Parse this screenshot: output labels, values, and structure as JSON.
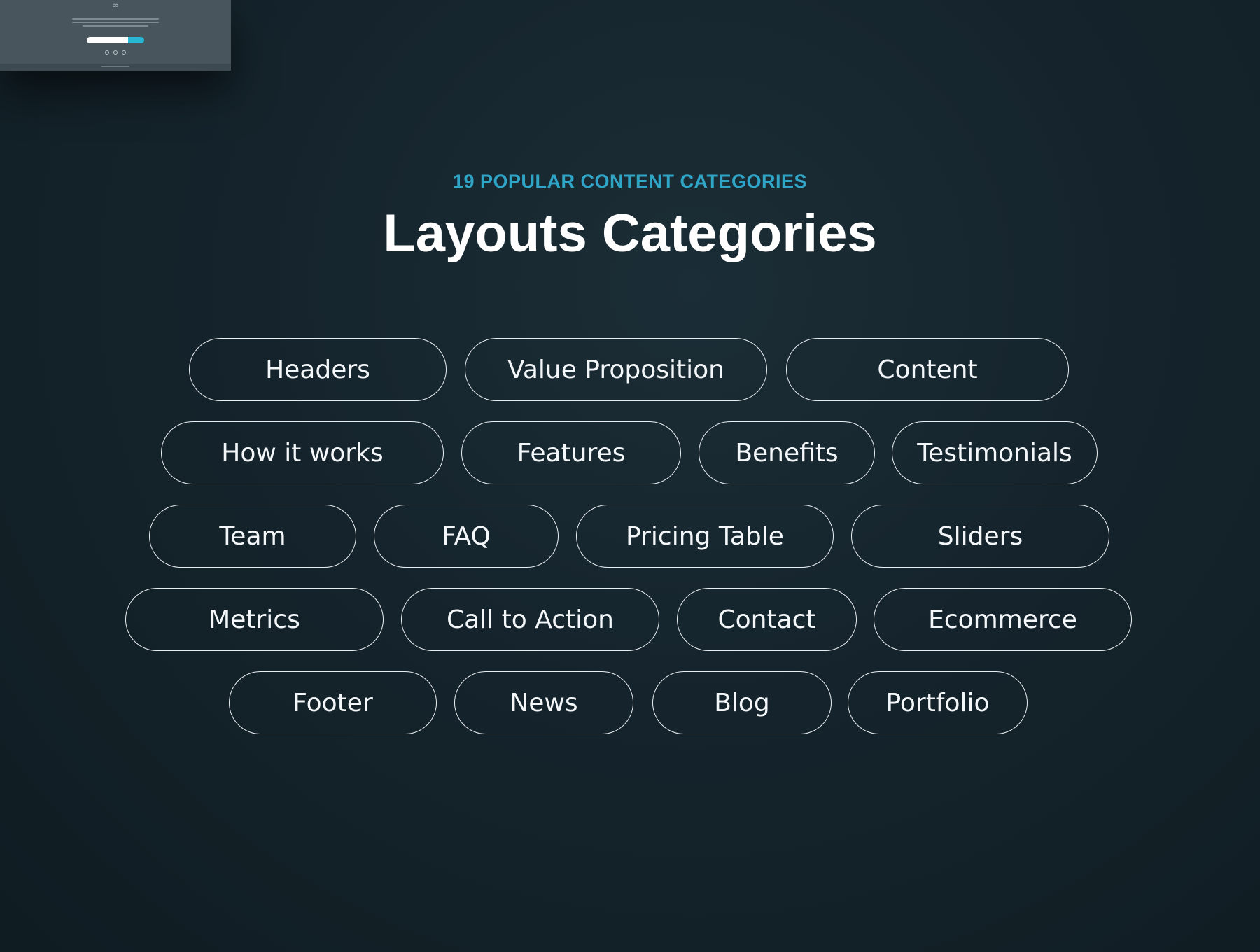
{
  "preview": {
    "logo_glyph": "∞"
  },
  "eyebrow": "19 POPULAR CONTENT CATEGORIES",
  "title": "Layouts Categories",
  "categories": [
    "Headers",
    "Value Proposition",
    "Content",
    "How it works",
    "Features",
    "Benefits",
    "Testimonials",
    "Team",
    "FAQ",
    "Pricing Table",
    "Sliders",
    "Metrics",
    "Call to Action",
    "Contact",
    "Ecommerce",
    "Footer",
    "News",
    "Blog",
    "Portfolio"
  ],
  "colors": {
    "accent": "#2fa6c8",
    "background": "#15242c",
    "pill_border": "#e9eef1"
  }
}
